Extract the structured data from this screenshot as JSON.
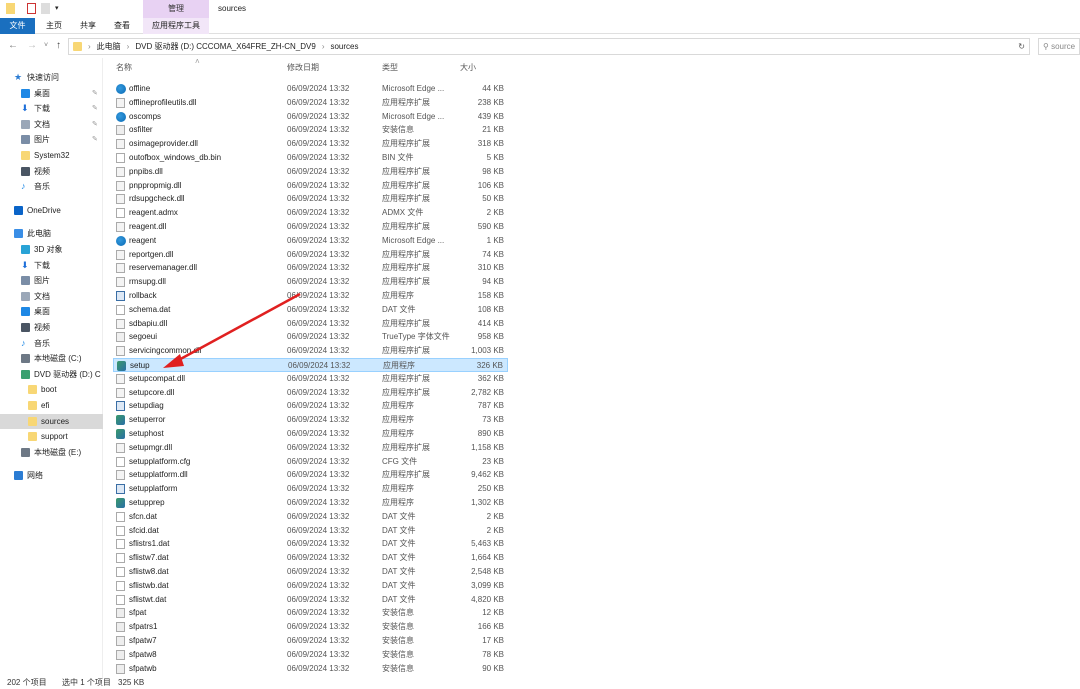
{
  "titlebar": {
    "title": "sources",
    "manage_tab": "管理"
  },
  "ribbon": {
    "tabs": [
      "文件",
      "主页",
      "共享",
      "查看"
    ],
    "context_tab": "应用程序工具"
  },
  "address": {
    "crumbs": [
      "此电脑",
      "DVD 驱动器 (D:) CCCOMA_X64FRE_ZH-CN_DV9",
      "sources"
    ],
    "search_placeholder": "搜索\"sources\"",
    "search_visible": "source"
  },
  "sidebar": {
    "items": [
      {
        "label": "快速访问",
        "icon": "star-icon",
        "indent": 0,
        "color": "#2b7cd3"
      },
      {
        "label": "桌面",
        "icon": "desktop-icon",
        "indent": 1,
        "pin": true,
        "color": "#1e88e5"
      },
      {
        "label": "下载",
        "icon": "download-icon",
        "indent": 1,
        "pin": true,
        "color": "#1e6fd9"
      },
      {
        "label": "文档",
        "icon": "document-icon",
        "indent": 1,
        "pin": true,
        "color": "#9aa7b8"
      },
      {
        "label": "图片",
        "icon": "pictures-icon",
        "indent": 1,
        "pin": true,
        "color": "#7a8da6"
      },
      {
        "label": "System32",
        "icon": "folder-icon",
        "indent": 1,
        "color": "#f8d775"
      },
      {
        "label": "视频",
        "icon": "video-icon",
        "indent": 1,
        "color": "#4a5563"
      },
      {
        "label": "音乐",
        "icon": "music-icon",
        "indent": 1,
        "color": "#1e88e5"
      },
      {
        "label": "OneDrive",
        "icon": "cloud-icon",
        "indent": 0,
        "color": "#0a64c8"
      },
      {
        "label": "此电脑",
        "icon": "computer-icon",
        "indent": 0,
        "color": "#3a8ee6"
      },
      {
        "label": "3D 对象",
        "icon": "cube-icon",
        "indent": 1,
        "color": "#29a3d6"
      },
      {
        "label": "下载",
        "icon": "download-icon",
        "indent": 1,
        "color": "#1e6fd9"
      },
      {
        "label": "图片",
        "icon": "pictures-icon",
        "indent": 1,
        "color": "#7a8da6"
      },
      {
        "label": "文档",
        "icon": "document-icon",
        "indent": 1,
        "color": "#9aa7b8"
      },
      {
        "label": "桌面",
        "icon": "desktop-icon",
        "indent": 1,
        "color": "#1e88e5"
      },
      {
        "label": "视频",
        "icon": "video-icon",
        "indent": 1,
        "color": "#4a5563"
      },
      {
        "label": "音乐",
        "icon": "music-icon",
        "indent": 1,
        "color": "#1e88e5"
      },
      {
        "label": "本地磁盘 (C:)",
        "icon": "drive-icon",
        "indent": 1,
        "color": "#6d7885"
      },
      {
        "label": "DVD 驱动器 (D:) C",
        "icon": "dvd-drive-icon",
        "indent": 1,
        "color": "#3aa070"
      },
      {
        "label": "boot",
        "icon": "folder-icon",
        "indent": 2,
        "color": "#f8d775"
      },
      {
        "label": "efi",
        "icon": "folder-icon",
        "indent": 2,
        "color": "#f8d775"
      },
      {
        "label": "sources",
        "icon": "folder-icon",
        "indent": 2,
        "selected": true,
        "color": "#f8d775"
      },
      {
        "label": "support",
        "icon": "folder-icon",
        "indent": 2,
        "color": "#f8d775"
      },
      {
        "label": "本地磁盘 (E:)",
        "icon": "drive-icon",
        "indent": 1,
        "color": "#6d7885"
      },
      {
        "label": "网络",
        "icon": "network-icon",
        "indent": 0,
        "color": "#2b7cd3"
      }
    ]
  },
  "list": {
    "columns": [
      "名称",
      "修改日期",
      "类型",
      "大小"
    ],
    "rows": [
      [
        "offline",
        "06/09/2024 13:32",
        "Microsoft Edge ...",
        "44 KB",
        "edge"
      ],
      [
        "offlineprofileutils.dll",
        "06/09/2024 13:32",
        "应用程序扩展",
        "238 KB",
        "dll"
      ],
      [
        "oscomps",
        "06/09/2024 13:32",
        "Microsoft Edge ...",
        "439 KB",
        "edge"
      ],
      [
        "osfilter",
        "06/09/2024 13:32",
        "安装信息",
        "21 KB",
        "inf"
      ],
      [
        "osimageprovider.dll",
        "06/09/2024 13:32",
        "应用程序扩展",
        "318 KB",
        "dll"
      ],
      [
        "outofbox_windows_db.bin",
        "06/09/2024 13:32",
        "BIN 文件",
        "5 KB",
        "file"
      ],
      [
        "pnpibs.dll",
        "06/09/2024 13:32",
        "应用程序扩展",
        "98 KB",
        "dll"
      ],
      [
        "pnppropmig.dll",
        "06/09/2024 13:32",
        "应用程序扩展",
        "106 KB",
        "dll"
      ],
      [
        "rdsupgcheck.dll",
        "06/09/2024 13:32",
        "应用程序扩展",
        "50 KB",
        "dll"
      ],
      [
        "reagent.admx",
        "06/09/2024 13:32",
        "ADMX 文件",
        "2 KB",
        "file"
      ],
      [
        "reagent.dll",
        "06/09/2024 13:32",
        "应用程序扩展",
        "590 KB",
        "dll"
      ],
      [
        "reagent",
        "06/09/2024 13:32",
        "Microsoft Edge ...",
        "1 KB",
        "edge"
      ],
      [
        "reportgen.dll",
        "06/09/2024 13:32",
        "应用程序扩展",
        "74 KB",
        "dll"
      ],
      [
        "reservemanager.dll",
        "06/09/2024 13:32",
        "应用程序扩展",
        "310 KB",
        "dll"
      ],
      [
        "rmsupg.dll",
        "06/09/2024 13:32",
        "应用程序扩展",
        "94 KB",
        "dll"
      ],
      [
        "rollback",
        "06/09/2024 13:32",
        "应用程序",
        "158 KB",
        "exe"
      ],
      [
        "schema.dat",
        "06/09/2024 13:32",
        "DAT 文件",
        "108 KB",
        "file"
      ],
      [
        "sdbapiu.dll",
        "06/09/2024 13:32",
        "应用程序扩展",
        "414 KB",
        "dll"
      ],
      [
        "segoeui",
        "06/09/2024 13:32",
        "TrueType 字体文件",
        "958 KB",
        "font"
      ],
      [
        "servicingcommon.dll",
        "06/09/2024 13:32",
        "应用程序扩展",
        "1,003 KB",
        "dll"
      ],
      [
        "setup",
        "06/09/2024 13:32",
        "应用程序",
        "326 KB",
        "setup"
      ],
      [
        "setupcompat.dll",
        "06/09/2024 13:32",
        "应用程序扩展",
        "362 KB",
        "dll"
      ],
      [
        "setupcore.dll",
        "06/09/2024 13:32",
        "应用程序扩展",
        "2,782 KB",
        "dll"
      ],
      [
        "setupdiag",
        "06/09/2024 13:32",
        "应用程序",
        "787 KB",
        "exe"
      ],
      [
        "setuperror",
        "06/09/2024 13:32",
        "应用程序",
        "73 KB",
        "setup"
      ],
      [
        "setuphost",
        "06/09/2024 13:32",
        "应用程序",
        "890 KB",
        "setup"
      ],
      [
        "setupmgr.dll",
        "06/09/2024 13:32",
        "应用程序扩展",
        "1,158 KB",
        "dll"
      ],
      [
        "setupplatform.cfg",
        "06/09/2024 13:32",
        "CFG 文件",
        "23 KB",
        "file"
      ],
      [
        "setupplatform.dll",
        "06/09/2024 13:32",
        "应用程序扩展",
        "9,462 KB",
        "dll"
      ],
      [
        "setupplatform",
        "06/09/2024 13:32",
        "应用程序",
        "250 KB",
        "exe"
      ],
      [
        "setupprep",
        "06/09/2024 13:32",
        "应用程序",
        "1,302 KB",
        "setup"
      ],
      [
        "sfcn.dat",
        "06/09/2024 13:32",
        "DAT 文件",
        "2 KB",
        "file"
      ],
      [
        "sfcid.dat",
        "06/09/2024 13:32",
        "DAT 文件",
        "2 KB",
        "file"
      ],
      [
        "sflistrs1.dat",
        "06/09/2024 13:32",
        "DAT 文件",
        "5,463 KB",
        "file"
      ],
      [
        "sflistw7.dat",
        "06/09/2024 13:32",
        "DAT 文件",
        "1,664 KB",
        "file"
      ],
      [
        "sflistw8.dat",
        "06/09/2024 13:32",
        "DAT 文件",
        "2,548 KB",
        "file"
      ],
      [
        "sflistwb.dat",
        "06/09/2024 13:32",
        "DAT 文件",
        "3,099 KB",
        "file"
      ],
      [
        "sflistwt.dat",
        "06/09/2024 13:32",
        "DAT 文件",
        "4,820 KB",
        "file"
      ],
      [
        "sfpat",
        "06/09/2024 13:32",
        "安装信息",
        "12 KB",
        "inf"
      ],
      [
        "sfpatrs1",
        "06/09/2024 13:32",
        "安装信息",
        "166 KB",
        "inf"
      ],
      [
        "sfpatw7",
        "06/09/2024 13:32",
        "安装信息",
        "17 KB",
        "inf"
      ],
      [
        "sfpatw8",
        "06/09/2024 13:32",
        "安装信息",
        "78 KB",
        "inf"
      ],
      [
        "sfpatwb",
        "06/09/2024 13:32",
        "安装信息",
        "90 KB",
        "inf"
      ]
    ],
    "selected": "setup"
  },
  "status": {
    "count": "202 个项目",
    "selected": "选中 1 个项目",
    "size": "325 KB"
  },
  "colors": {
    "accent": "#1a6fbf",
    "selection": "#cce8ff",
    "arrow": "#e02020",
    "manage": "#e8d2f3"
  }
}
